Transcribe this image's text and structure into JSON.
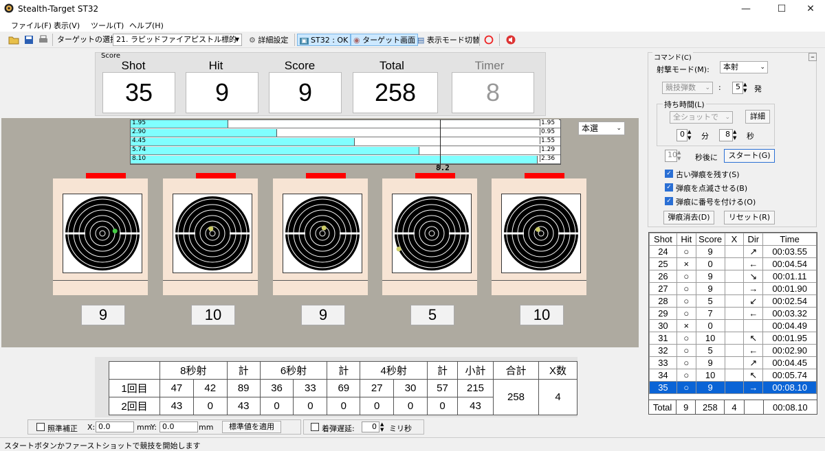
{
  "window": {
    "title": "Stealth-Target ST32"
  },
  "menu": [
    "ファイル(F)",
    "表示(V)",
    "ツール(T)",
    "ヘルプ(H)"
  ],
  "toolbar": {
    "target_select_label": "ターゲットの選択:",
    "target_value": "21. ラピッドファイアピストル標的",
    "settings": "詳細設定",
    "status": "ST32 : OK",
    "target_screen": "ターゲット画面",
    "display_mode": "表示モード切替"
  },
  "scorebox": {
    "label": "Score",
    "shot_h": "Shot",
    "hit_h": "Hit",
    "score_h": "Score",
    "total_h": "Total",
    "timer_h": "Timer",
    "shot": "35",
    "hit": "9",
    "score": "9",
    "total": "258",
    "timer": "8"
  },
  "bars": [
    {
      "left": "1.95",
      "right": "1.95",
      "frac": 0.24
    },
    {
      "left": "2.90",
      "right": "0.95",
      "frac": 0.36
    },
    {
      "left": "4.45",
      "right": "1.55",
      "frac": 0.55
    },
    {
      "left": "5.74",
      "right": "1.29",
      "frac": 0.71
    },
    {
      "left": "8.10",
      "right": "2.36",
      "frac": 1.0
    }
  ],
  "marker": "8.2",
  "range_select": "本選",
  "targets": [
    {
      "score": "9"
    },
    {
      "score": "10"
    },
    {
      "score": "9"
    },
    {
      "score": "5"
    },
    {
      "score": "10"
    }
  ],
  "ring_numbers": [
    "5",
    "6",
    "7",
    "8",
    "9",
    "9",
    "8",
    "7",
    "6",
    "5"
  ],
  "scoretable": {
    "headers": [
      "",
      "8秒射",
      "",
      "計",
      "6秒射",
      "",
      "計",
      "4秒射",
      "",
      "計",
      "小計",
      "合計",
      "X数"
    ],
    "row1": {
      "label": "1回目",
      "v": [
        "47",
        "42",
        "89",
        "36",
        "33",
        "69",
        "27",
        "30",
        "57",
        "215"
      ]
    },
    "row2": {
      "label": "2回目",
      "v": [
        "43",
        "0",
        "43",
        "0",
        "0",
        "0",
        "0",
        "0",
        "0",
        "43"
      ]
    },
    "total": "258",
    "x": "4"
  },
  "options": {
    "aim_label": "照準補正",
    "x_label": "X:",
    "x": "0.0",
    "mm1": "mm",
    "y_label": "Y:",
    "y": "0.0",
    "mm2": "mm",
    "apply": "標準値を適用",
    "delay_label": "着弾遅延:",
    "delay": "0",
    "ms": "ミリ秒"
  },
  "status": "スタートボタンかファーストショットで競技を開始します",
  "command": {
    "title": "コマンド(C)",
    "mode_label": "射撃モード(M):",
    "mode": "本射",
    "count_sel": "競技弾数",
    "count": "5",
    "count_unit": "発",
    "hold_title": "持ち時間(L)",
    "all_shots": "全ショットで",
    "detail": "詳細",
    "min": "0",
    "min_unit": "分",
    "sec": "8",
    "sec_unit": "秒",
    "delay": "10",
    "delay_label": "秒後に",
    "start": "スタート(G)",
    "opt1": "古い弾痕を残す(S)",
    "opt2": "弾痕を点滅させる(B)",
    "opt3": "弾痕に番号を付ける(O)",
    "clear": "弾痕消去(D)",
    "reset": "リセット(R)"
  },
  "shots": {
    "headers": [
      "Shot",
      "Hit",
      "Score",
      "X",
      "Dir",
      "Time"
    ],
    "rows": [
      [
        "24",
        "○",
        "9",
        "",
        "↗",
        "00:03.55"
      ],
      [
        "25",
        "×",
        "0",
        "",
        "←",
        "00:04.54"
      ],
      [
        "26",
        "○",
        "9",
        "",
        "↘",
        "00:01.11"
      ],
      [
        "27",
        "○",
        "9",
        "",
        "→",
        "00:01.90"
      ],
      [
        "28",
        "○",
        "5",
        "",
        "↙",
        "00:02.54"
      ],
      [
        "29",
        "○",
        "7",
        "",
        "←",
        "00:03.32"
      ],
      [
        "30",
        "×",
        "0",
        "",
        "",
        "00:04.49"
      ],
      [
        "31",
        "○",
        "10",
        "",
        "↖",
        "00:01.95"
      ],
      [
        "32",
        "○",
        "5",
        "",
        "←",
        "00:02.90"
      ],
      [
        "33",
        "○",
        "9",
        "",
        "↗",
        "00:04.45"
      ],
      [
        "34",
        "○",
        "10",
        "",
        "↖",
        "00:05.74"
      ],
      [
        "35",
        "○",
        "9",
        "",
        "→",
        "00:08.10"
      ]
    ],
    "total": [
      "Total",
      "9",
      "258",
      "4",
      "",
      "00:08.10"
    ]
  }
}
